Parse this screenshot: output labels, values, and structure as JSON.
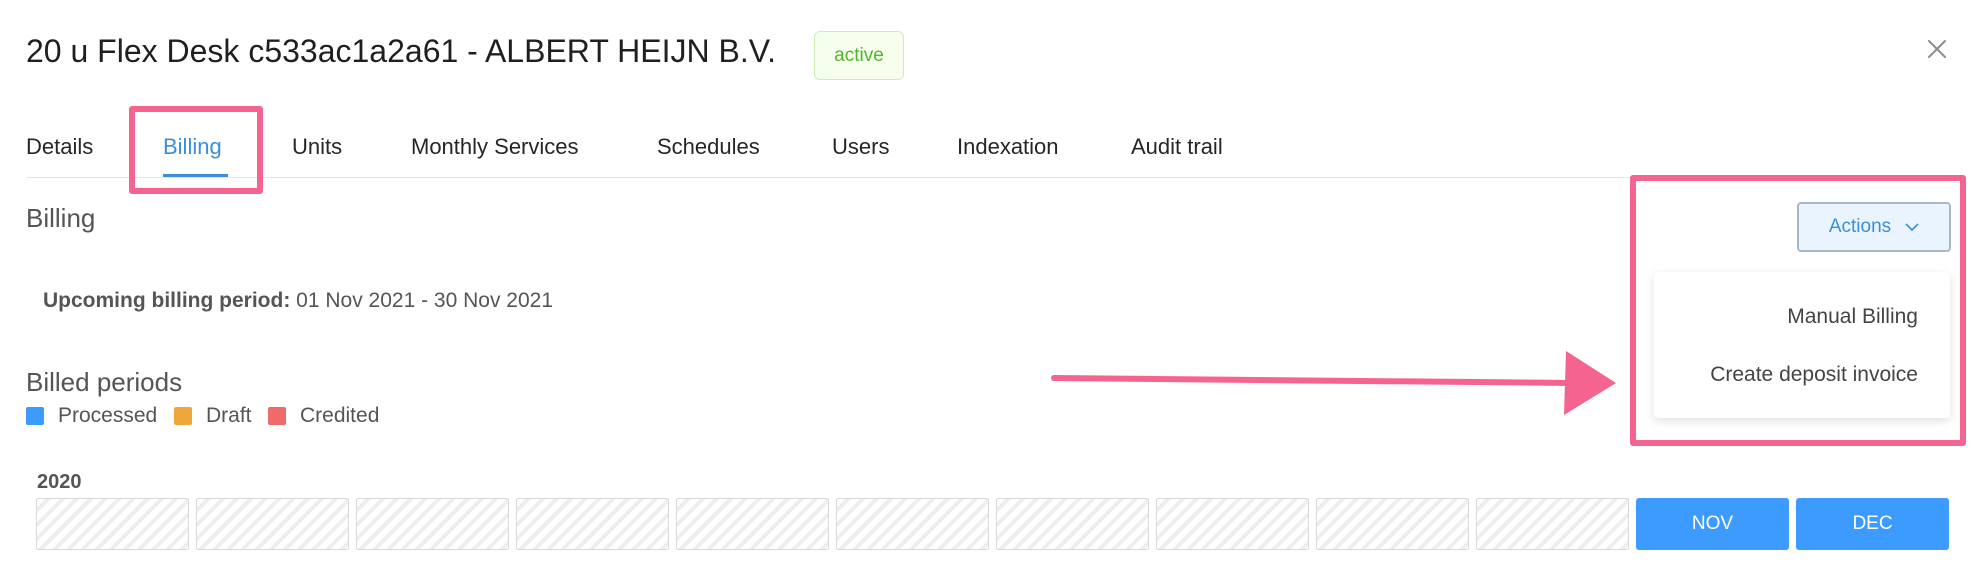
{
  "header": {
    "title": "20 u Flex Desk c533ac1a2a61 - ALBERT HEIJN B.V.",
    "status": "active",
    "close_icon": "close-icon"
  },
  "tabs": [
    {
      "label": "Details",
      "active": false
    },
    {
      "label": "Billing",
      "active": true
    },
    {
      "label": "Units",
      "active": false
    },
    {
      "label": "Monthly Services",
      "active": false
    },
    {
      "label": "Schedules",
      "active": false
    },
    {
      "label": "Users",
      "active": false
    },
    {
      "label": "Indexation",
      "active": false
    },
    {
      "label": "Audit trail",
      "active": false
    }
  ],
  "billing": {
    "section_title": "Billing",
    "upcoming_label": "Upcoming billing period:",
    "upcoming_value": "01 Nov 2021 - 30 Nov 2021",
    "billed_periods_title": "Billed periods",
    "legend": [
      {
        "label": "Processed",
        "color": "#3d9bff"
      },
      {
        "label": "Draft",
        "color": "#f0a73a"
      },
      {
        "label": "Credited",
        "color": "#f06a6a"
      }
    ],
    "year": "2020",
    "months": [
      {
        "label": "",
        "state": "disabled"
      },
      {
        "label": "",
        "state": "disabled"
      },
      {
        "label": "",
        "state": "disabled"
      },
      {
        "label": "",
        "state": "disabled"
      },
      {
        "label": "",
        "state": "disabled"
      },
      {
        "label": "",
        "state": "disabled"
      },
      {
        "label": "",
        "state": "disabled"
      },
      {
        "label": "",
        "state": "disabled"
      },
      {
        "label": "",
        "state": "disabled"
      },
      {
        "label": "",
        "state": "disabled"
      },
      {
        "label": "NOV",
        "state": "processed"
      },
      {
        "label": "DEC",
        "state": "processed"
      }
    ]
  },
  "actions": {
    "button_label": "Actions",
    "button_icon": "chevron-down-icon",
    "menu_items": [
      "Manual Billing",
      "Create deposit invoice"
    ]
  },
  "annotations": {
    "highlight_color": "#f5648e"
  }
}
